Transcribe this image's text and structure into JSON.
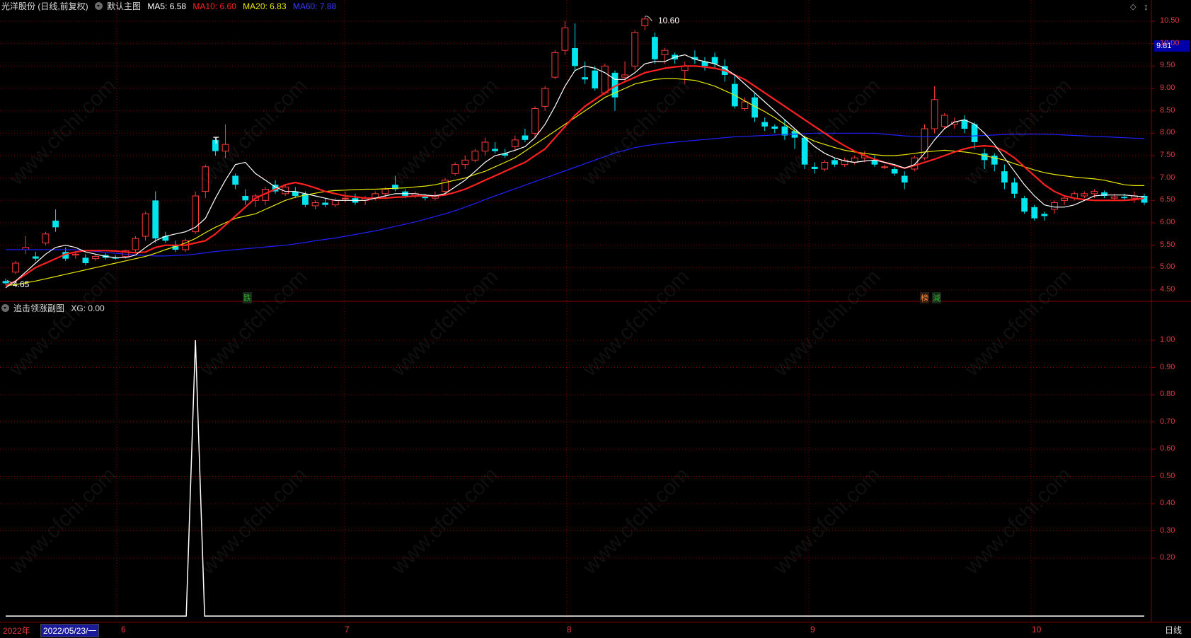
{
  "stock_title": "光洋股份 (日线,前复权)",
  "main_chart": {
    "name": "默认主图",
    "ma5": "MA5: 6.58",
    "ma10": "MA10: 6.60",
    "ma20": "MA20: 6.83",
    "ma60": "MA60: 7.88",
    "high_label": "10.60",
    "low_label": "4.65",
    "current_price": "9.81",
    "markers": [
      "T"
    ],
    "signal_badges": [
      "跌",
      "榜",
      "減"
    ],
    "y_ticks": [
      "10.50",
      "10.00",
      "9.50",
      "9.00",
      "8.50",
      "8.00",
      "7.50",
      "7.00",
      "6.50",
      "6.00",
      "5.50",
      "5.00",
      "4.50"
    ]
  },
  "sub_chart": {
    "name": "追击领涨副图",
    "xg": "XG: 0.00",
    "y_ticks": [
      "1.00",
      "0.90",
      "0.80",
      "0.70",
      "0.60",
      "0.50",
      "0.40",
      "0.30",
      "0.20"
    ]
  },
  "bottom_bar": {
    "year": "2022年",
    "date": "2022/05/23/一",
    "months": [
      "6",
      "7",
      "8",
      "9",
      "10"
    ],
    "period": "日线"
  },
  "colors": {
    "up": "#ff3a3a",
    "down": "#00e5ee",
    "ma5": "#ffffff",
    "ma10": "#ff2020",
    "ma20": "#e8e800",
    "ma60": "#2020ff",
    "grid": "#8b0000"
  },
  "chart_data": {
    "type": "candlestick",
    "ylim": [
      4.5,
      10.6
    ],
    "candles": [
      [
        4.7,
        4.75,
        4.62,
        4.65
      ],
      [
        4.9,
        5.15,
        4.85,
        5.1
      ],
      [
        5.4,
        5.7,
        5.3,
        5.45
      ],
      [
        5.25,
        5.35,
        5.15,
        5.2
      ],
      [
        5.55,
        5.8,
        5.5,
        5.75
      ],
      [
        6.05,
        6.3,
        5.8,
        5.9
      ],
      [
        5.35,
        5.45,
        5.15,
        5.2
      ],
      [
        5.28,
        5.35,
        5.2,
        5.3
      ],
      [
        5.22,
        5.3,
        5.05,
        5.1
      ],
      [
        5.2,
        5.3,
        5.15,
        5.25
      ],
      [
        5.28,
        5.32,
        5.18,
        5.22
      ],
      [
        5.22,
        5.28,
        5.18,
        5.2
      ],
      [
        5.25,
        5.4,
        5.2,
        5.38
      ],
      [
        5.4,
        5.7,
        5.35,
        5.65
      ],
      [
        5.7,
        6.25,
        5.6,
        6.2
      ],
      [
        6.5,
        6.7,
        5.55,
        5.65
      ],
      [
        5.7,
        5.8,
        5.55,
        5.6
      ],
      [
        5.5,
        5.6,
        5.35,
        5.4
      ],
      [
        5.4,
        5.65,
        5.35,
        5.6
      ],
      [
        5.8,
        6.7,
        5.75,
        6.6
      ],
      [
        6.7,
        7.3,
        6.55,
        7.25
      ],
      [
        7.85,
        7.9,
        7.5,
        7.6
      ],
      [
        7.6,
        8.2,
        7.45,
        7.75
      ],
      [
        7.05,
        7.1,
        6.75,
        6.85
      ],
      [
        6.6,
        6.75,
        6.4,
        6.5
      ],
      [
        6.5,
        6.65,
        6.35,
        6.6
      ],
      [
        6.5,
        6.8,
        6.4,
        6.75
      ],
      [
        6.85,
        6.95,
        6.65,
        6.7
      ],
      [
        6.65,
        6.85,
        6.6,
        6.8
      ],
      [
        6.7,
        6.8,
        6.55,
        6.6
      ],
      [
        6.65,
        6.7,
        6.35,
        6.4
      ],
      [
        6.38,
        6.5,
        6.3,
        6.45
      ],
      [
        6.45,
        6.55,
        6.35,
        6.4
      ],
      [
        6.4,
        6.55,
        6.35,
        6.5
      ],
      [
        6.55,
        6.7,
        6.45,
        6.55
      ],
      [
        6.55,
        6.65,
        6.4,
        6.45
      ],
      [
        6.5,
        6.6,
        6.4,
        6.55
      ],
      [
        6.55,
        6.7,
        6.5,
        6.65
      ],
      [
        6.65,
        6.8,
        6.55,
        6.75
      ],
      [
        6.85,
        7.05,
        6.7,
        6.75
      ],
      [
        6.7,
        6.75,
        6.55,
        6.6
      ],
      [
        6.6,
        6.7,
        6.55,
        6.65
      ],
      [
        6.58,
        6.65,
        6.5,
        6.55
      ],
      [
        6.55,
        6.7,
        6.5,
        6.6
      ],
      [
        6.7,
        7.0,
        6.65,
        6.95
      ],
      [
        7.1,
        7.35,
        7.05,
        7.3
      ],
      [
        7.3,
        7.5,
        7.2,
        7.4
      ],
      [
        7.4,
        7.65,
        7.35,
        7.6
      ],
      [
        7.6,
        7.9,
        7.5,
        7.8
      ],
      [
        7.65,
        7.8,
        7.55,
        7.6
      ],
      [
        7.55,
        7.65,
        7.45,
        7.5
      ],
      [
        7.7,
        7.95,
        7.6,
        7.85
      ],
      [
        7.95,
        8.1,
        7.8,
        7.85
      ],
      [
        8.0,
        8.6,
        7.9,
        8.55
      ],
      [
        8.6,
        9.05,
        8.5,
        9.0
      ],
      [
        9.25,
        9.85,
        9.2,
        9.8
      ],
      [
        9.85,
        10.5,
        9.75,
        10.35
      ],
      [
        9.9,
        10.45,
        9.4,
        9.5
      ],
      [
        9.25,
        9.6,
        9.1,
        9.2
      ],
      [
        9.4,
        9.5,
        8.95,
        9.0
      ],
      [
        8.9,
        9.55,
        8.85,
        9.5
      ],
      [
        9.35,
        9.4,
        8.5,
        8.8
      ],
      [
        9.25,
        9.6,
        9.15,
        9.3
      ],
      [
        9.5,
        10.3,
        9.4,
        10.25
      ],
      [
        10.4,
        10.6,
        10.3,
        10.55
      ],
      [
        10.15,
        10.25,
        9.55,
        9.65
      ],
      [
        9.75,
        9.9,
        9.55,
        9.85
      ],
      [
        9.75,
        9.8,
        9.55,
        9.65
      ],
      [
        9.4,
        9.6,
        9.1,
        9.5
      ],
      [
        9.7,
        9.85,
        9.55,
        9.65
      ],
      [
        9.6,
        9.7,
        9.4,
        9.5
      ],
      [
        9.7,
        9.8,
        9.45,
        9.55
      ],
      [
        9.5,
        9.65,
        9.15,
        9.3
      ],
      [
        9.1,
        9.3,
        8.55,
        8.6
      ],
      [
        8.55,
        8.8,
        8.5,
        8.7
      ],
      [
        8.8,
        8.9,
        8.25,
        8.35
      ],
      [
        8.25,
        8.35,
        8.05,
        8.15
      ],
      [
        8.15,
        8.2,
        8.0,
        8.1
      ],
      [
        8.15,
        8.3,
        7.85,
        7.95
      ],
      [
        8.05,
        8.1,
        7.65,
        7.9
      ],
      [
        7.9,
        7.95,
        7.2,
        7.3
      ],
      [
        7.25,
        7.35,
        7.1,
        7.2
      ],
      [
        7.2,
        7.4,
        7.15,
        7.35
      ],
      [
        7.4,
        7.45,
        7.25,
        7.3
      ],
      [
        7.3,
        7.45,
        7.25,
        7.4
      ],
      [
        7.35,
        7.5,
        7.3,
        7.45
      ],
      [
        7.45,
        7.6,
        7.35,
        7.5
      ],
      [
        7.4,
        7.5,
        7.25,
        7.3
      ],
      [
        7.25,
        7.3,
        7.2,
        7.25
      ],
      [
        7.2,
        7.25,
        7.05,
        7.1
      ],
      [
        7.05,
        7.15,
        6.75,
        6.9
      ],
      [
        7.2,
        7.5,
        7.15,
        7.45
      ],
      [
        7.45,
        8.2,
        7.4,
        8.1
      ],
      [
        8.1,
        9.05,
        8.0,
        8.75
      ],
      [
        8.15,
        8.45,
        8.1,
        8.4
      ],
      [
        8.2,
        8.35,
        8.1,
        8.25
      ],
      [
        8.3,
        8.4,
        8.0,
        8.1
      ],
      [
        8.2,
        8.25,
        7.65,
        7.8
      ],
      [
        7.55,
        7.65,
        7.2,
        7.4
      ],
      [
        7.5,
        7.55,
        7.15,
        7.3
      ],
      [
        7.15,
        7.3,
        6.75,
        6.9
      ],
      [
        6.9,
        7.0,
        6.55,
        6.65
      ],
      [
        6.55,
        6.6,
        6.2,
        6.25
      ],
      [
        6.35,
        6.4,
        6.05,
        6.1
      ],
      [
        6.2,
        6.25,
        6.05,
        6.15
      ],
      [
        6.3,
        6.5,
        6.2,
        6.45
      ],
      [
        6.5,
        6.6,
        6.4,
        6.55
      ],
      [
        6.55,
        6.7,
        6.5,
        6.65
      ],
      [
        6.6,
        6.7,
        6.55,
        6.65
      ],
      [
        6.65,
        6.75,
        6.55,
        6.7
      ],
      [
        6.68,
        6.72,
        6.55,
        6.6
      ],
      [
        6.55,
        6.65,
        6.5,
        6.58
      ],
      [
        6.58,
        6.65,
        6.5,
        6.55
      ],
      [
        6.55,
        6.7,
        6.45,
        6.6
      ],
      [
        6.6,
        6.65,
        6.4,
        6.45
      ]
    ],
    "ma5": [
      4.55,
      4.7,
      4.9,
      5.1,
      5.3,
      5.45,
      5.5,
      5.45,
      5.35,
      5.3,
      5.25,
      5.22,
      5.22,
      5.28,
      5.45,
      5.6,
      5.7,
      5.75,
      5.8,
      5.9,
      6.1,
      6.55,
      6.95,
      7.3,
      7.35,
      7.1,
      6.95,
      6.8,
      6.7,
      6.7,
      6.65,
      6.6,
      6.55,
      6.5,
      6.5,
      6.5,
      6.5,
      6.55,
      6.6,
      6.65,
      6.65,
      6.65,
      6.62,
      6.6,
      6.65,
      6.8,
      6.95,
      7.15,
      7.35,
      7.5,
      7.55,
      7.62,
      7.7,
      7.9,
      8.2,
      8.6,
      9.05,
      9.4,
      9.5,
      9.45,
      9.35,
      9.2,
      9.2,
      9.35,
      9.55,
      9.6,
      9.6,
      9.7,
      9.75,
      9.65,
      9.6,
      9.55,
      9.45,
      9.3,
      9.1,
      8.9,
      8.7,
      8.5,
      8.3,
      8.1,
      7.9,
      7.7,
      7.55,
      7.45,
      7.38,
      7.35,
      7.38,
      7.4,
      7.35,
      7.3,
      7.22,
      7.3,
      7.55,
      7.85,
      8.1,
      8.25,
      8.3,
      8.2,
      8.0,
      7.75,
      7.45,
      7.15,
      6.85,
      6.6,
      6.4,
      6.35,
      6.35,
      6.4,
      6.5,
      6.6,
      6.62,
      6.62,
      6.62,
      6.6,
      6.58
    ],
    "ma10": [
      4.6,
      4.7,
      4.85,
      5.0,
      5.1,
      5.2,
      5.3,
      5.35,
      5.38,
      5.38,
      5.38,
      5.37,
      5.35,
      5.33,
      5.35,
      5.45,
      5.5,
      5.5,
      5.5,
      5.55,
      5.6,
      5.75,
      5.95,
      6.15,
      6.35,
      6.55,
      6.65,
      6.75,
      6.85,
      6.9,
      6.85,
      6.78,
      6.7,
      6.65,
      6.6,
      6.58,
      6.55,
      6.55,
      6.55,
      6.57,
      6.58,
      6.6,
      6.6,
      6.6,
      6.62,
      6.68,
      6.75,
      6.85,
      6.95,
      7.05,
      7.15,
      7.25,
      7.35,
      7.5,
      7.65,
      7.9,
      8.15,
      8.4,
      8.6,
      8.75,
      8.9,
      9.05,
      9.15,
      9.25,
      9.35,
      9.4,
      9.45,
      9.48,
      9.5,
      9.5,
      9.48,
      9.45,
      9.4,
      9.3,
      9.2,
      9.05,
      8.9,
      8.75,
      8.6,
      8.45,
      8.3,
      8.15,
      8.0,
      7.85,
      7.72,
      7.6,
      7.5,
      7.42,
      7.35,
      7.28,
      7.22,
      7.28,
      7.35,
      7.42,
      7.5,
      7.58,
      7.65,
      7.7,
      7.72,
      7.7,
      7.6,
      7.45,
      7.25,
      7.05,
      6.85,
      6.7,
      6.6,
      6.55,
      6.52,
      6.5,
      6.5,
      6.5,
      6.5,
      6.52,
      6.55
    ],
    "ma20": [
      4.6,
      4.62,
      4.66,
      4.7,
      4.75,
      4.8,
      4.85,
      4.9,
      4.95,
      5.0,
      5.05,
      5.1,
      5.15,
      5.2,
      5.25,
      5.32,
      5.4,
      5.47,
      5.55,
      5.65,
      5.78,
      5.9,
      6.0,
      6.1,
      6.15,
      6.2,
      6.3,
      6.4,
      6.5,
      6.57,
      6.62,
      6.66,
      6.7,
      6.72,
      6.73,
      6.74,
      6.75,
      6.75,
      6.76,
      6.77,
      6.78,
      6.8,
      6.82,
      6.85,
      6.9,
      6.95,
      7.0,
      7.08,
      7.15,
      7.25,
      7.35,
      7.45,
      7.6,
      7.75,
      7.9,
      8.05,
      8.2,
      8.35,
      8.5,
      8.65,
      8.8,
      8.9,
      9.0,
      9.1,
      9.15,
      9.2,
      9.22,
      9.22,
      9.2,
      9.18,
      9.12,
      9.05,
      8.95,
      8.85,
      8.72,
      8.6,
      8.48,
      8.35,
      8.2,
      8.05,
      7.92,
      7.82,
      7.75,
      7.68,
      7.62,
      7.58,
      7.55,
      7.52,
      7.5,
      7.5,
      7.52,
      7.55,
      7.58,
      7.6,
      7.62,
      7.6,
      7.58,
      7.55,
      7.5,
      7.45,
      7.4,
      7.32,
      7.25,
      7.18,
      7.12,
      7.08,
      7.05,
      7.02,
      7.0,
      6.98,
      6.95,
      6.9,
      6.85,
      6.83,
      6.83
    ],
    "ma60": [
      5.4,
      5.4,
      5.4,
      5.4,
      5.4,
      5.4,
      5.4,
      5.4,
      5.38,
      5.36,
      5.34,
      5.32,
      5.3,
      5.28,
      5.27,
      5.26,
      5.26,
      5.27,
      5.28,
      5.3,
      5.33,
      5.36,
      5.38,
      5.4,
      5.42,
      5.44,
      5.46,
      5.48,
      5.5,
      5.53,
      5.56,
      5.6,
      5.63,
      5.66,
      5.7,
      5.74,
      5.78,
      5.82,
      5.87,
      5.92,
      5.97,
      6.02,
      6.08,
      6.14,
      6.2,
      6.27,
      6.35,
      6.43,
      6.52,
      6.6,
      6.68,
      6.76,
      6.84,
      6.92,
      7.0,
      7.08,
      7.16,
      7.24,
      7.32,
      7.4,
      7.48,
      7.56,
      7.62,
      7.68,
      7.72,
      7.75,
      7.78,
      7.8,
      7.82,
      7.84,
      7.86,
      7.88,
      7.9,
      7.92,
      7.93,
      7.94,
      7.95,
      7.96,
      7.97,
      7.98,
      7.99,
      8.0,
      8.0,
      8.0,
      8.0,
      8.0,
      8.0,
      8.0,
      7.98,
      7.96,
      7.94,
      7.93,
      7.92,
      7.92,
      7.92,
      7.92,
      7.93,
      7.94,
      7.95,
      7.96,
      7.97,
      7.98,
      7.98,
      7.98,
      7.98,
      7.97,
      7.96,
      7.95,
      7.94,
      7.93,
      7.92,
      7.91,
      7.9,
      7.89,
      7.88
    ],
    "xg": {
      "spike_index": 19,
      "value": 1.0,
      "baseline": 0.0
    }
  }
}
